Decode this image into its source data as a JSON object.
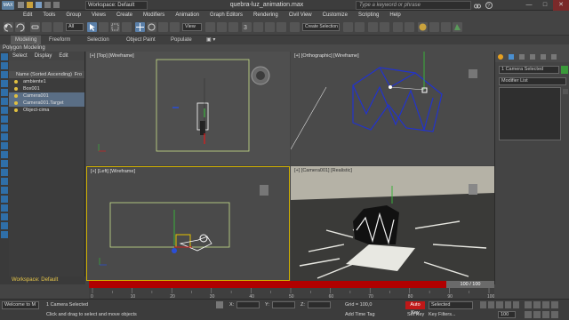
{
  "titlebar": {
    "logo": "MAX",
    "workspace": "Workspace: Default",
    "title": "quebra-luz_animation.max",
    "search_placeholder": "Type a keyword or phrase",
    "min": "—",
    "max": "□",
    "close": "✕"
  },
  "menu": [
    "Edit",
    "Tools",
    "Group",
    "Views",
    "Create",
    "Modifiers",
    "Animation",
    "Graph Editors",
    "Rendering",
    "Civil View",
    "Customize",
    "Scripting",
    "Help"
  ],
  "toolbar": {
    "selection_filter": "All",
    "view_dropdown": "View",
    "named_sel": "Create Selection Se"
  },
  "ribbon": {
    "tabs": [
      "Modeling",
      "Freeform",
      "Selection",
      "Object Paint",
      "Populate"
    ],
    "sub": "Polygon Modeling"
  },
  "explorer": {
    "menu": [
      "Select",
      "Display",
      "Edit"
    ],
    "header": "Name (Sorted Ascending)",
    "header_right": "Fro",
    "items": [
      {
        "label": "ambiente1",
        "selected": false
      },
      {
        "label": "Box001",
        "selected": false
      },
      {
        "label": "Camera001",
        "selected": true
      },
      {
        "label": "Camera001.Target",
        "selected": true
      },
      {
        "label": "Object-cima",
        "selected": false
      }
    ],
    "workspace": "Workspace: Default"
  },
  "viewports": {
    "top": "[+] [Top] [Wireframe]",
    "ortho": "[+] [Orthographic] [Wireframe]",
    "left": "[+] [Left] [Wireframe]",
    "camera": "[+] [Camera001] [Realistic]"
  },
  "cmdpanel": {
    "object_name": "1 Camera Selected",
    "modifier_list": "Modifier List"
  },
  "timeline": {
    "frame": "100 / 100",
    "ticks": [
      "0",
      "10",
      "20",
      "30",
      "40",
      "50",
      "60",
      "70",
      "80",
      "90",
      "100"
    ]
  },
  "status": {
    "welcome": "Welcome to M",
    "selected": "1 Camera Selected",
    "prompt": "Click and drag to select and move objects",
    "x_label": "X:",
    "y_label": "Y:",
    "z_label": "Z:",
    "grid": "Grid = 100,0",
    "add_tag": "Add Time Tag",
    "autokey": "Auto Key",
    "setkey": "Set Key",
    "selected_dd": "Selected",
    "key_filters": "Key Filters...",
    "frame_field": "100"
  },
  "colors": {
    "accent": "#5a6e85",
    "autokey": "#c01818",
    "trackbar": "#b00000",
    "yellow": "#e8c74a"
  }
}
